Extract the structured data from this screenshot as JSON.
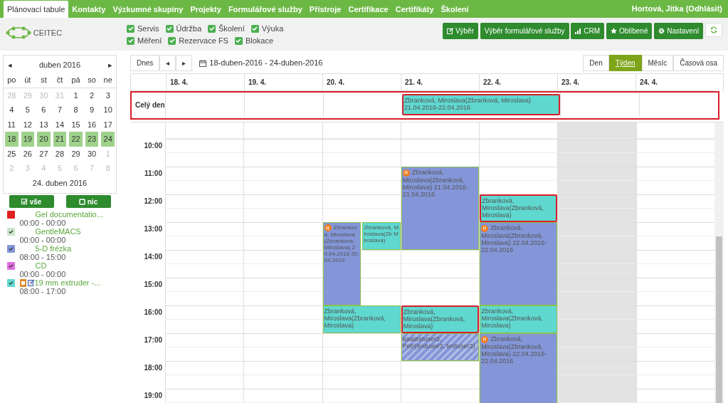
{
  "nav": {
    "tabs": [
      {
        "label": "Plánovací tabule",
        "selected": true
      },
      {
        "label": "Kontakty",
        "selected": false
      },
      {
        "label": "Výzkumné skupiny",
        "selected": false
      },
      {
        "label": "Projekty",
        "selected": false
      },
      {
        "label": "Formulářové služby",
        "selected": false
      },
      {
        "label": "Přístroje",
        "selected": false
      },
      {
        "label": "Certifikace",
        "selected": false
      },
      {
        "label": "Certifikáty",
        "selected": false
      },
      {
        "label": "Školení",
        "selected": false
      }
    ],
    "user": "Hortová, Jitka (Odhlásit)"
  },
  "logo": "CEITEC",
  "filters": [
    {
      "label": "Servis",
      "checked": true
    },
    {
      "label": "Údržba",
      "checked": true
    },
    {
      "label": "Školení",
      "checked": true
    },
    {
      "label": "Výuka",
      "checked": true
    },
    {
      "label": "Měření",
      "checked": true
    },
    {
      "label": "Rezervace FS",
      "checked": true
    },
    {
      "label": "Blokace",
      "checked": true
    }
  ],
  "actions": [
    {
      "label": "Výběr",
      "kind": "edit"
    },
    {
      "label": "Výběr formulářové služby",
      "kind": "plain"
    },
    {
      "label": "CRM",
      "kind": "chart"
    },
    {
      "label": "Oblíbené",
      "kind": "star"
    },
    {
      "label": "Nastavení",
      "kind": "gear"
    },
    {
      "kind": "refresh"
    }
  ],
  "mini_calendar": {
    "prev": "◂",
    "month": "duben 2016",
    "next": "▸",
    "weekdays": [
      "po",
      "út",
      "st",
      "čt",
      "pá",
      "so",
      "ne"
    ],
    "weeks": [
      [
        {
          "d": "28",
          "muted": true,
          "selected": false
        },
        {
          "d": "29",
          "muted": true,
          "selected": false
        },
        {
          "d": "30",
          "muted": true,
          "selected": false
        },
        {
          "d": "31",
          "muted": true,
          "selected": false
        },
        {
          "d": "1",
          "muted": false,
          "selected": false
        },
        {
          "d": "2",
          "muted": false,
          "selected": false
        },
        {
          "d": "3",
          "muted": false,
          "selected": false
        }
      ],
      [
        {
          "d": "4",
          "muted": false,
          "selected": false
        },
        {
          "d": "5",
          "muted": false,
          "selected": false
        },
        {
          "d": "6",
          "muted": false,
          "selected": false
        },
        {
          "d": "7",
          "muted": false,
          "selected": false
        },
        {
          "d": "8",
          "muted": false,
          "selected": false
        },
        {
          "d": "9",
          "muted": false,
          "selected": false
        },
        {
          "d": "10",
          "muted": false,
          "selected": false
        }
      ],
      [
        {
          "d": "11",
          "muted": false,
          "selected": false
        },
        {
          "d": "12",
          "muted": false,
          "selected": false
        },
        {
          "d": "13",
          "muted": false,
          "selected": false
        },
        {
          "d": "14",
          "muted": false,
          "selected": false
        },
        {
          "d": "15",
          "muted": false,
          "selected": false
        },
        {
          "d": "16",
          "muted": false,
          "selected": false
        },
        {
          "d": "17",
          "muted": false,
          "selected": false
        }
      ],
      [
        {
          "d": "18",
          "muted": false,
          "selected": true
        },
        {
          "d": "19",
          "muted": false,
          "selected": true
        },
        {
          "d": "20",
          "muted": false,
          "selected": true
        },
        {
          "d": "21",
          "muted": false,
          "selected": true
        },
        {
          "d": "22",
          "muted": false,
          "selected": true
        },
        {
          "d": "23",
          "muted": false,
          "selected": true
        },
        {
          "d": "24",
          "muted": false,
          "selected": true
        }
      ],
      [
        {
          "d": "25",
          "muted": false,
          "selected": false
        },
        {
          "d": "26",
          "muted": false,
          "selected": false
        },
        {
          "d": "27",
          "muted": false,
          "selected": false
        },
        {
          "d": "28",
          "muted": false,
          "selected": false
        },
        {
          "d": "29",
          "muted": false,
          "selected": false
        },
        {
          "d": "30",
          "muted": false,
          "selected": false
        },
        {
          "d": "1",
          "muted": true,
          "selected": false
        }
      ],
      [
        {
          "d": "2",
          "muted": true,
          "selected": false
        },
        {
          "d": "3",
          "muted": true,
          "selected": false
        },
        {
          "d": "4",
          "muted": true,
          "selected": false
        },
        {
          "d": "5",
          "muted": true,
          "selected": false
        },
        {
          "d": "6",
          "muted": true,
          "selected": false
        },
        {
          "d": "7",
          "muted": true,
          "selected": false
        },
        {
          "d": "8",
          "muted": true,
          "selected": false
        }
      ]
    ],
    "footer": "24. duben 2016"
  },
  "select_buttons": [
    {
      "label": "vše",
      "kind": "all"
    },
    {
      "label": "nic",
      "kind": "none"
    }
  ],
  "resources": [
    {
      "name": "Gel documentatio...",
      "time": "00:00 - 00:00",
      "color": "#e0201e",
      "checked": false,
      "icons": false
    },
    {
      "name": "GentleMACS",
      "time": "00:00 - 00:00",
      "color": "#c8e6c9",
      "checked": true,
      "icons": false
    },
    {
      "name": "5-D frézka",
      "time": "08:00 - 15:00",
      "color": "#8496d8",
      "checked": true,
      "icons": false
    },
    {
      "name": "CD",
      "time": "00:00 - 00:00",
      "color": "#e070e0",
      "checked": true,
      "icons": false
    },
    {
      "name": "19 mm extruder -...",
      "time": "08:00 - 17:00",
      "color": "#5fd8d0",
      "checked": true,
      "icons": true
    }
  ],
  "toolbar": {
    "today": "Dnes",
    "prev": "◂",
    "next": "▸",
    "range": "18-duben-2016 - 24-duben-2016",
    "views": [
      {
        "label": "Den",
        "selected": false
      },
      {
        "label": "Týden",
        "selected": true
      },
      {
        "label": "Měsíc",
        "selected": false
      },
      {
        "label": "Časová osa",
        "selected": false
      }
    ]
  },
  "week": {
    "days": [
      {
        "label": "18. 4.",
        "shaded": false
      },
      {
        "label": "19. 4.",
        "shaded": false
      },
      {
        "label": "20. 4.",
        "shaded": false
      },
      {
        "label": "21. 4.",
        "shaded": false
      },
      {
        "label": "22. 4.",
        "shaded": false
      },
      {
        "label": "23. 4.",
        "shaded": true
      },
      {
        "label": "24. 4.",
        "shaded": false
      }
    ],
    "all_day_label": "Celý den",
    "all_day_events": [
      {
        "text": "Zbranková, Miroslava(Zbranková, Miroslava) 21.04.2016-22.04.2016",
        "color": "#5fd8d0",
        "highlighted": true
      }
    ],
    "hours": [
      "10:00",
      "11:00",
      "12:00",
      "13:00",
      "14:00",
      "15:00",
      "16:00",
      "17:00",
      "18:00",
      "19:00"
    ],
    "events": [
      {
        "text": "Zbranková, Miroslava(Zbranková, Miroslava) 20.04.2016 20.04.2016",
        "color": "#8496d8",
        "badge": "R",
        "highlighted": false,
        "striped": false
      },
      {
        "text": "Zbranková, Miroslava(Zb Miroslava)",
        "color": "#5fd8d0",
        "highlighted": false,
        "striped": false
      },
      {
        "text": "Zbranková, Miroslava(Zbranková, Miroslava)",
        "color": "#5fd8d0",
        "highlighted": false,
        "striped": false
      },
      {
        "text": "Zbranková, Miroslava(Zbranková, Miroslava) 21.04.2016-21.04.2016",
        "color": "#8496d8",
        "badge": "R",
        "highlighted": false,
        "striped": false
      },
      {
        "text": "Zbranková, Miroslava(Zbranková, Miroslava)",
        "color": "#5fd8d0",
        "highlighted": true,
        "striped": false
      },
      {
        "text": "aaatestuser3, Petr(testuser3, testuser3)",
        "color": "#8496d8",
        "highlighted": false,
        "striped": true
      },
      {
        "text": "Zbranková, Miroslava(Zbranková, Miroslava)",
        "color": "#5fd8d0",
        "highlighted": true,
        "striped": false
      },
      {
        "text": "Zbranková, Miroslava(Zbranková, Miroslava) 22.04.2016-22.04.2016",
        "color": "#8496d8",
        "badge": "R",
        "highlighted": false,
        "striped": false
      },
      {
        "text": "Zbranková, Miroslava(Zbranková, Miroslava)",
        "color": "#5fd8d0",
        "highlighted": false,
        "striped": false
      },
      {
        "text": "Zbranková, Miroslava(Zbranková, Miroslava) 22.04.2016-22.04.2016",
        "color": "#8496d8",
        "badge": "R",
        "highlighted": false,
        "striped": false
      }
    ]
  }
}
